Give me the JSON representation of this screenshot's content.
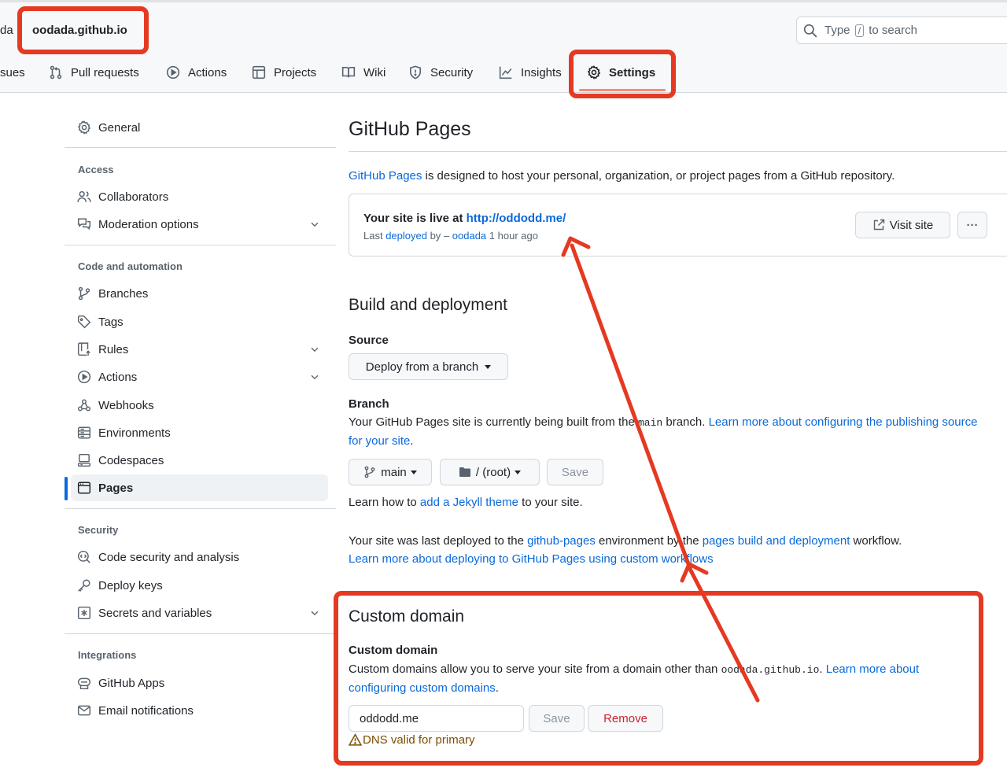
{
  "header": {
    "repo_prefix": "da",
    "repo_name": "oodada.github.io",
    "search": {
      "before": "Type",
      "key": "/",
      "after": "to search"
    }
  },
  "nav": {
    "items": [
      {
        "label": "sues",
        "icon": "issue-icon"
      },
      {
        "label": "Pull requests",
        "icon": "pull-request-icon"
      },
      {
        "label": "Actions",
        "icon": "play-icon"
      },
      {
        "label": "Projects",
        "icon": "table-icon"
      },
      {
        "label": "Wiki",
        "icon": "book-icon"
      },
      {
        "label": "Security",
        "icon": "shield-icon"
      },
      {
        "label": "Insights",
        "icon": "graph-icon"
      },
      {
        "label": "Settings",
        "icon": "gear-icon",
        "active": true
      }
    ]
  },
  "sidebar": {
    "general": "General",
    "access_heading": "Access",
    "collaborators": "Collaborators",
    "moderation": "Moderation options",
    "code_heading": "Code and automation",
    "branches": "Branches",
    "tags": "Tags",
    "rules": "Rules",
    "actions": "Actions",
    "webhooks": "Webhooks",
    "environments": "Environments",
    "codespaces": "Codespaces",
    "pages": "Pages",
    "security_heading": "Security",
    "code_security": "Code security and analysis",
    "deploy_keys": "Deploy keys",
    "secrets": "Secrets and variables",
    "integrations_heading": "Integrations",
    "github_apps": "GitHub Apps",
    "email_notifications": "Email notifications"
  },
  "main": {
    "title": "GitHub Pages",
    "intro_link": "GitHub Pages",
    "intro_rest": " is designed to host your personal, organization, or project pages from a GitHub repository.",
    "live": {
      "prefix": "Your site is live at ",
      "url": "http://oddodd.me/",
      "meta_last": "Last ",
      "meta_deployed": "deployed",
      "meta_by": " by ",
      "meta_dash": " – ",
      "meta_user": "oodada",
      "meta_time": " 1 hour ago",
      "visit_label": "Visit site",
      "more_label": "···"
    },
    "build": {
      "title": "Build and deployment",
      "source_label": "Source",
      "source_value": "Deploy from a branch",
      "branch_label": "Branch",
      "branch_text_1": "Your GitHub Pages site is currently being built from the ",
      "branch_code": "main",
      "branch_text_2": " branch. ",
      "branch_link": "Learn more about configuring the publishing source for your site",
      "branch_end": ".",
      "branch_select": "main",
      "folder_select": "/ (root)",
      "save_label": "Save",
      "jekyll_1": "Learn how to ",
      "jekyll_link": "add a Jekyll theme",
      "jekyll_2": " to your site.",
      "deployed_1": "Your site was last deployed to the ",
      "deployed_env": "github-pages",
      "deployed_2": " environment by the ",
      "deployed_workflow": "pages build and deployment",
      "deployed_3": " workflow.",
      "deployed_link": "Learn more about deploying to GitHub Pages using custom workflows"
    },
    "custom": {
      "title": "Custom domain",
      "label": "Custom domain",
      "text_1": "Custom domains allow you to serve your site from a domain other than ",
      "text_code": "oodada.github.io",
      "text_2": ". ",
      "text_link": "Learn more about configuring custom domains",
      "text_end": ".",
      "input_value": "oddodd.me",
      "save_label": "Save",
      "remove_label": "Remove",
      "dns_status": "DNS valid for primary"
    }
  },
  "colors": {
    "annotation": "#e53922",
    "link": "#0969da",
    "danger": "#cf222e",
    "warning": "#7d4e00"
  }
}
